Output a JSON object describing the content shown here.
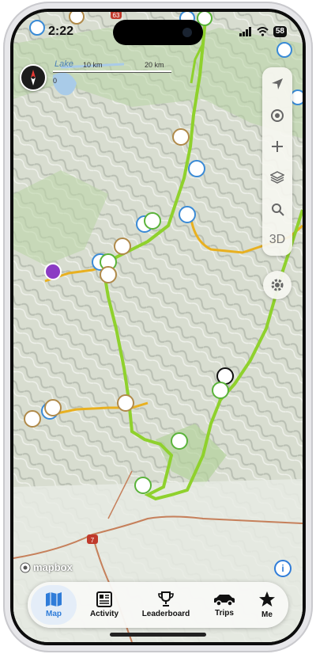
{
  "status_bar": {
    "time": "2:22",
    "battery": "58"
  },
  "map": {
    "lake_label": "Lake",
    "scale": {
      "start": "0",
      "mid": "10 km",
      "end": "20 km"
    },
    "road_shields": [
      "63",
      "7"
    ],
    "compass": "compass-icon"
  },
  "toolbar": {
    "items": [
      "locate-arrow-icon",
      "track-location-icon",
      "zoom-in-icon",
      "layers-icon",
      "search-icon",
      "3d-toggle"
    ],
    "three_d_label": "3D"
  },
  "attribution": {
    "brand": "mapbox"
  },
  "tabs": [
    {
      "label": "Map",
      "icon": "map-icon",
      "active": true
    },
    {
      "label": "Activity",
      "icon": "activity-icon",
      "active": false
    },
    {
      "label": "Leaderboard",
      "icon": "trophy-icon",
      "active": false
    },
    {
      "label": "Trips",
      "icon": "car-icon",
      "active": false
    },
    {
      "label": "Me",
      "icon": "star-icon",
      "active": false
    }
  ],
  "colors": {
    "accent": "#2f7cd9",
    "trail_green": "#7ed321",
    "road_orange": "#e8b020",
    "pin_tan": "#b08a4a",
    "pin_green": "#5ab33a",
    "pin_blue": "#3a8ad6",
    "pin_purple": "#8b3cc4"
  }
}
